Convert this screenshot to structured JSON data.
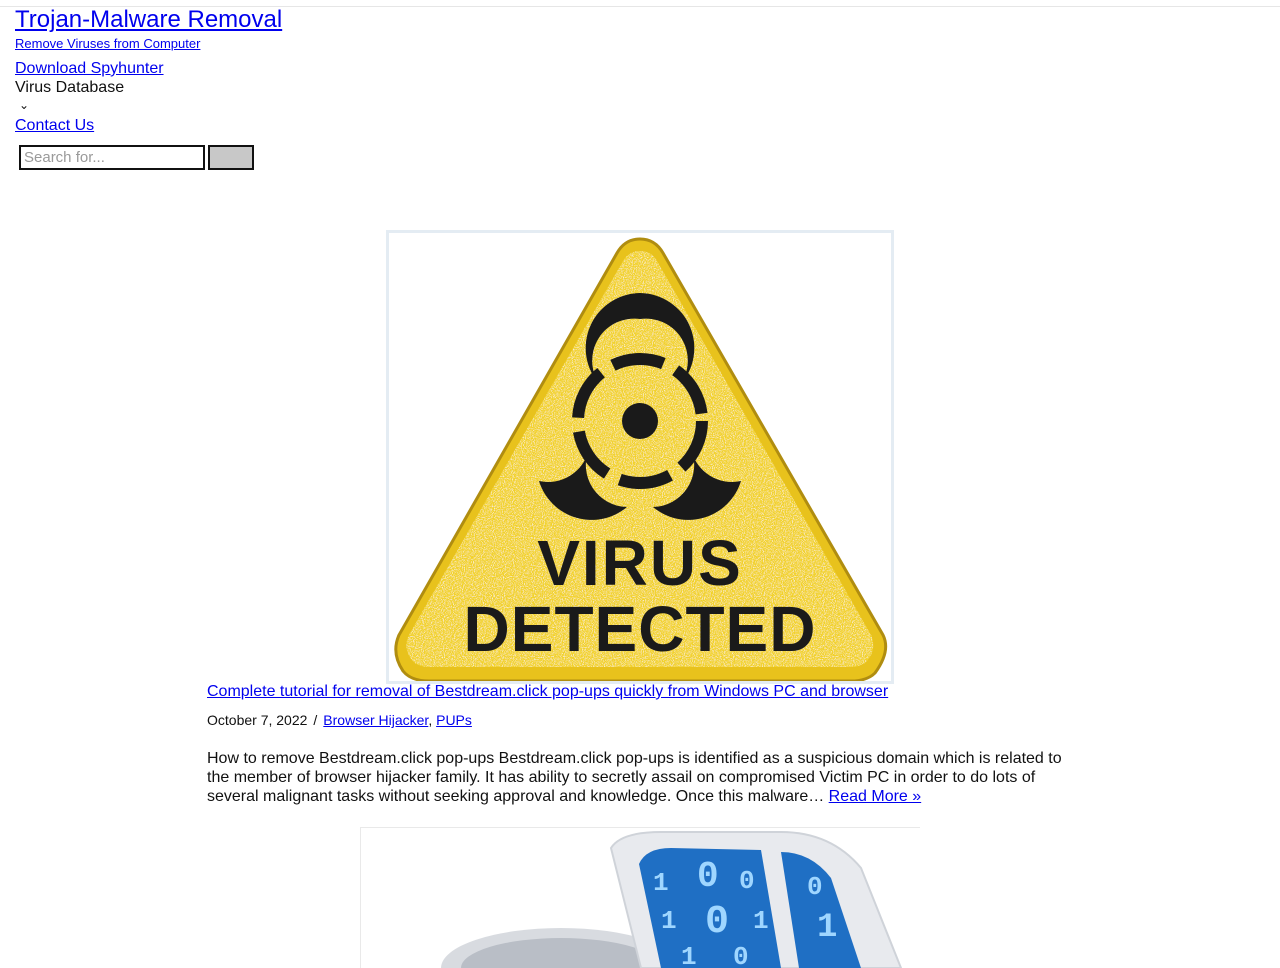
{
  "site": {
    "title": "Trojan-Malware Removal",
    "tagline": "Remove Viruses from Computer"
  },
  "nav": {
    "items": [
      {
        "label": "Download Spyhunter"
      },
      {
        "label": "Virus Database"
      },
      {
        "label": "Contact Us"
      }
    ]
  },
  "search": {
    "placeholder": "Search for..."
  },
  "posts": [
    {
      "image_text": [
        "VIRUS",
        "DETECTED"
      ],
      "title": "Complete tutorial for removal of Bestdream.click pop-ups quickly from Windows PC and browser",
      "date": "October 7, 2022",
      "meta_separator": "/",
      "categories": [
        "Browser Hijacker",
        "PUPs"
      ],
      "excerpt": "How to remove Bestdream.click pop-ups Bestdream.click pop-ups is identified as a suspicious domain which is related to the member of browser hijacker family. It has ability to secretly assail on compromised Victim PC in order to do lots of several malignant tasks without seeking approval and knowledge. Once this malware…",
      "read_more": "Read More »"
    },
    {
      "image_text": [
        "1",
        "0",
        "0",
        "1",
        "0",
        "1",
        "0",
        "1",
        "1",
        "0"
      ]
    }
  ],
  "colors": {
    "link": "#0000ee",
    "warning_yellow": "#f2d22a",
    "hazard_black": "#1a1a1a",
    "screen_blue": "#2a8ae0"
  }
}
